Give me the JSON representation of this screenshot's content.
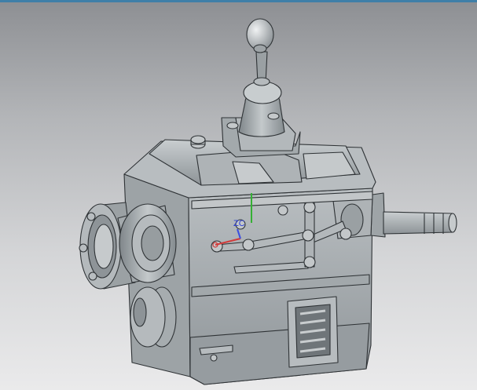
{
  "viewport": {
    "background_top": "#8d8f93",
    "background_bottom": "#eaeaeb",
    "title_strip_color": "#3f7fa8"
  },
  "model": {
    "body_color": "#a7adb0",
    "edge_color": "#2f3336"
  },
  "triad": {
    "label": "ZC",
    "x_axis_color": "#d23b3b",
    "y_axis_color": "#35b035",
    "z_axis_color": "#3a4fe0"
  }
}
